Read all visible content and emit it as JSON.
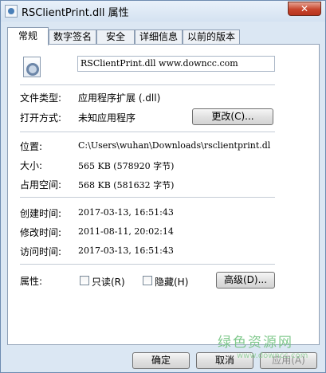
{
  "window": {
    "title": "RSClientPrint.dll 属性",
    "close_glyph": "✕"
  },
  "tabs": [
    {
      "label": "常规",
      "active": true
    },
    {
      "label": "数字签名",
      "active": false
    },
    {
      "label": "安全",
      "active": false
    },
    {
      "label": "详细信息",
      "active": false
    },
    {
      "label": "以前的版本",
      "active": false
    }
  ],
  "general": {
    "file_name": "RSClientPrint.dll  www.downcc.com",
    "file_type_label": "文件类型:",
    "file_type_value": "应用程序扩展 (.dll)",
    "open_with_label": "打开方式:",
    "open_with_value": "未知应用程序",
    "change_button": "更改(C)...",
    "location_label": "位置:",
    "location_value": "C:\\Users\\wuhan\\Downloads\\rsclientprint.dl",
    "size_label": "大小:",
    "size_value": "565 KB (578920 字节)",
    "size_on_disk_label": "占用空间:",
    "size_on_disk_value": "568 KB (581632 字节)",
    "created_label": "创建时间:",
    "created_value": "2017-03-13, 16:51:43",
    "modified_label": "修改时间:",
    "modified_value": "2011-08-11, 20:02:14",
    "accessed_label": "访问时间:",
    "accessed_value": "2017-03-13, 16:51:43",
    "attributes_label": "属性:",
    "readonly_label": "只读(R)",
    "readonly_checked": false,
    "hidden_label": "隐藏(H)",
    "hidden_checked": false,
    "advanced_button": "高级(D)..."
  },
  "footer": {
    "ok_button": "确定",
    "cancel_button": "取消",
    "apply_button": "应用(A)"
  },
  "watermark": {
    "text": "绿色资源网",
    "url": "www.downcc.com"
  }
}
